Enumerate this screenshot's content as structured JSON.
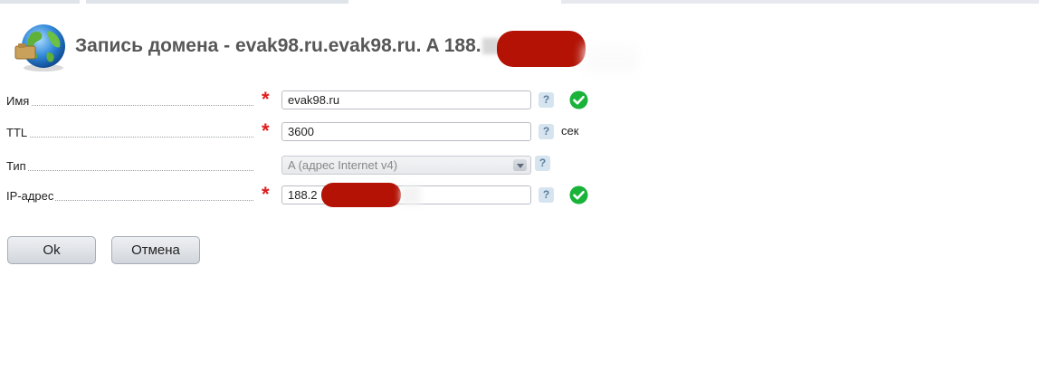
{
  "header": {
    "title_visible": "Запись домена - evak98.ru.evak98.ru. A 188."
  },
  "form": {
    "name": {
      "label": "Имя",
      "value": "evak98.ru",
      "help": "?"
    },
    "ttl": {
      "label": "TTL",
      "value": "3600",
      "unit": "сек",
      "help": "?"
    },
    "type": {
      "label": "Тип",
      "value": "A (адрес Internet v4)",
      "help": "?"
    },
    "ip": {
      "label": "IP-адрес",
      "value_visible": "188.2",
      "help": "?"
    },
    "required_mark": "*"
  },
  "buttons": {
    "ok": "Ok",
    "cancel": "Отмена"
  },
  "colors": {
    "required": "#e01b1b",
    "valid": "#19b33a",
    "redaction": "#b31205"
  },
  "icons": {
    "logo": "globe-icon",
    "valid": "check-circle-icon",
    "help": "help-icon",
    "dropdown": "chevron-down-icon"
  }
}
